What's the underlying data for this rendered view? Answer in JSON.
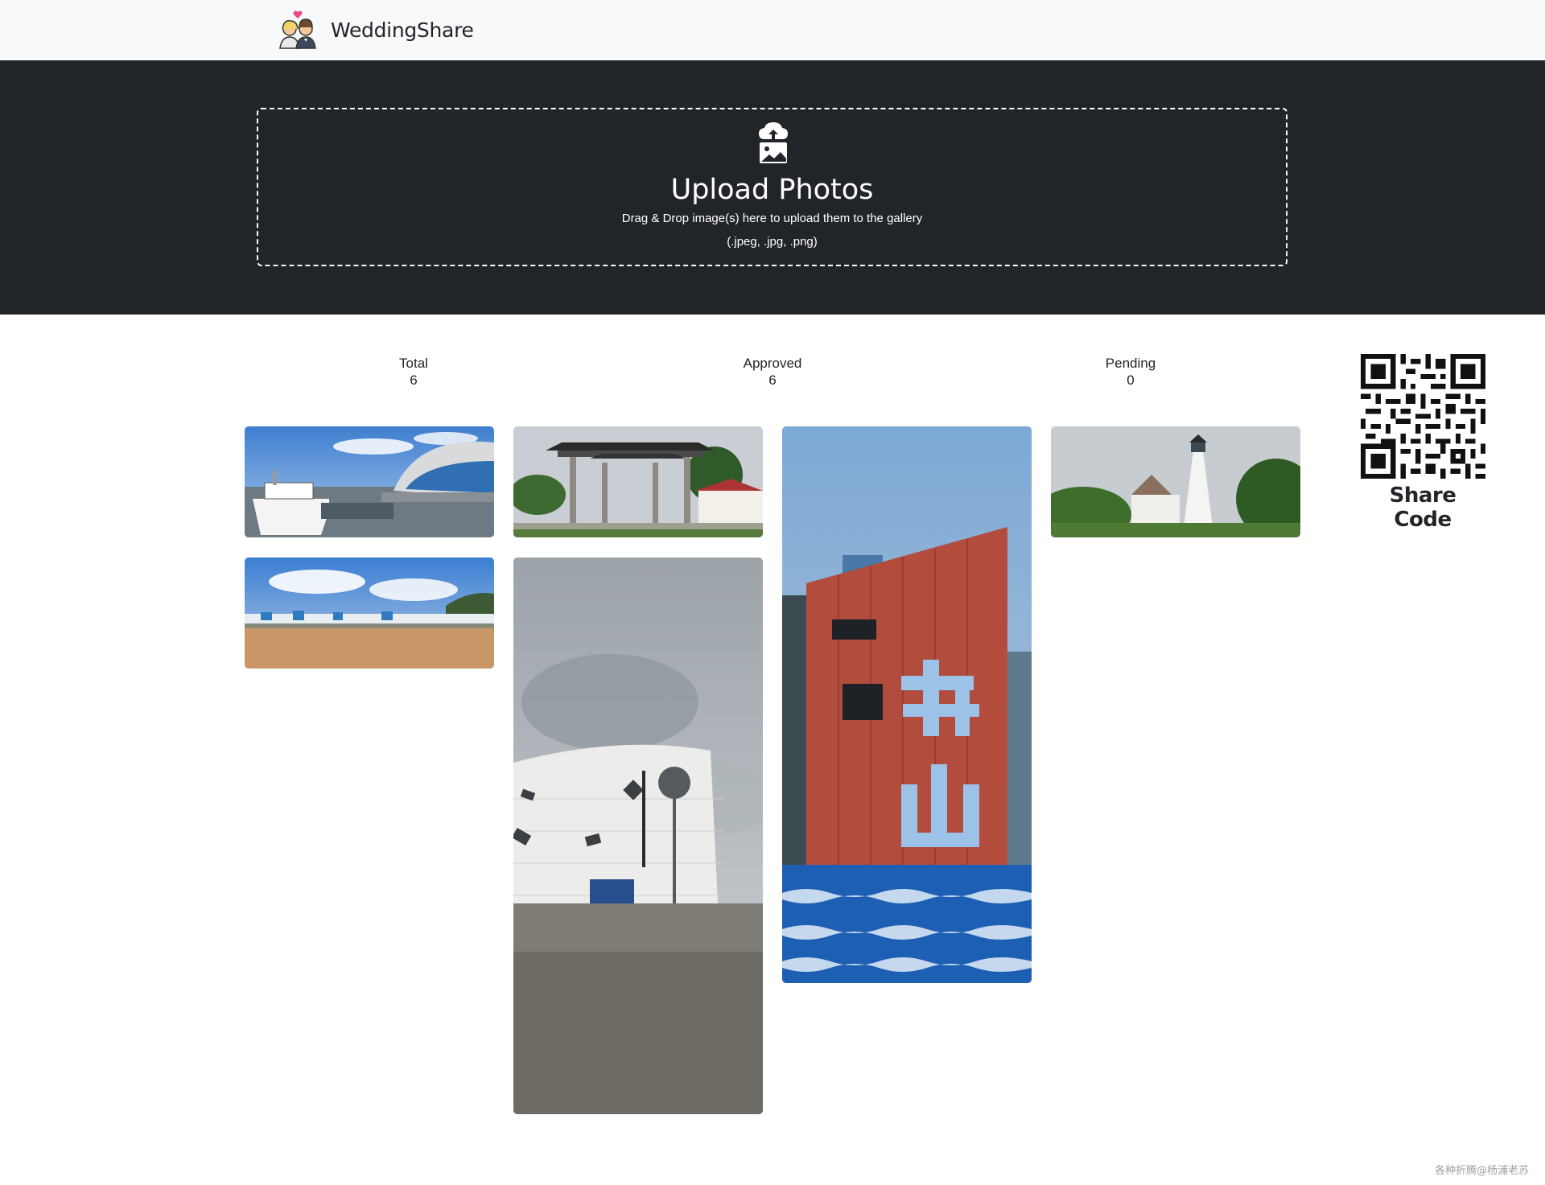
{
  "navbar": {
    "brand": "WeddingShare",
    "logo_icon": "wedding-couple-icon"
  },
  "upload": {
    "icon": "upload-image-icon",
    "title": "Upload Photos",
    "hint": "Drag & Drop image(s) here to upload them to the gallery",
    "types": "(.jpeg, .jpg, .png)"
  },
  "stats": {
    "total": {
      "label": "Total",
      "value": "6"
    },
    "approved": {
      "label": "Approved",
      "value": "6"
    },
    "pending": {
      "label": "Pending",
      "value": "0"
    }
  },
  "share": {
    "title": "Share Code",
    "icon": "qr-code-icon"
  },
  "gallery": {
    "photos": [
      {
        "subject": "ferry-terminal"
      },
      {
        "subject": "paifang-gate"
      },
      {
        "subject": "red-tower-zhoushan"
      },
      {
        "subject": "lighthouse"
      },
      {
        "subject": "beach-town"
      },
      {
        "subject": "typhoon-museum"
      }
    ]
  },
  "watermark": "各种折腾@杨浦老苏",
  "colors": {
    "navbar_bg": "#f8f9fa",
    "hero_bg": "#212529",
    "text": "#212529"
  }
}
